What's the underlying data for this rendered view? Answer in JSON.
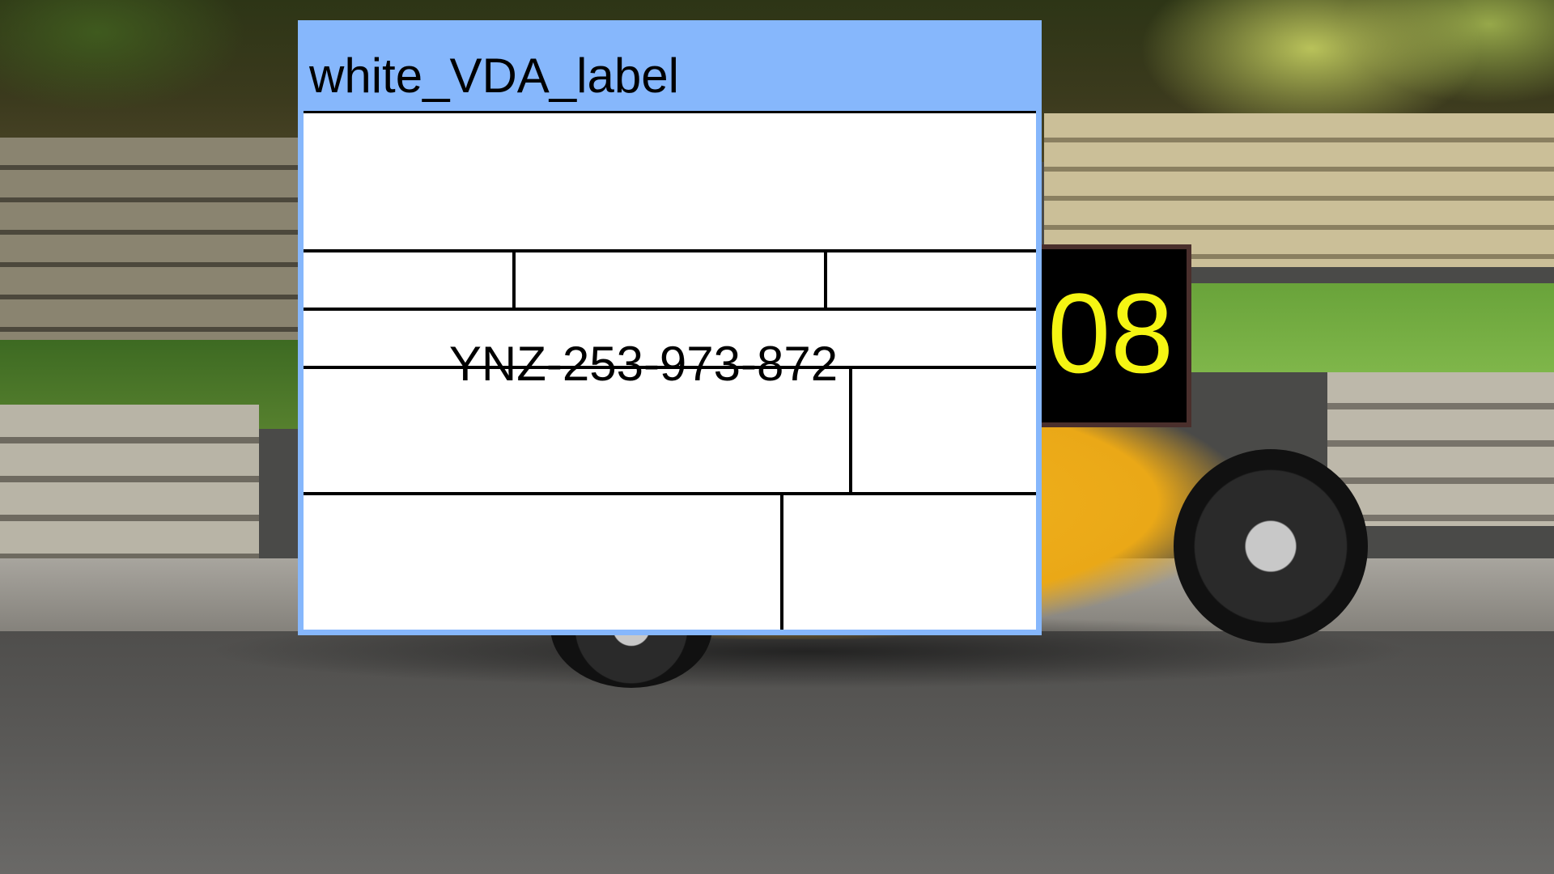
{
  "window": {
    "title": "white_VDA_label"
  },
  "label": {
    "code": "YNZ-253-973-872"
  },
  "badge": {
    "text": "08",
    "text_color": "#f5f513",
    "background": "#000000"
  },
  "colors": {
    "window_frame": "#86b7fc",
    "label_background": "#ffffff"
  }
}
